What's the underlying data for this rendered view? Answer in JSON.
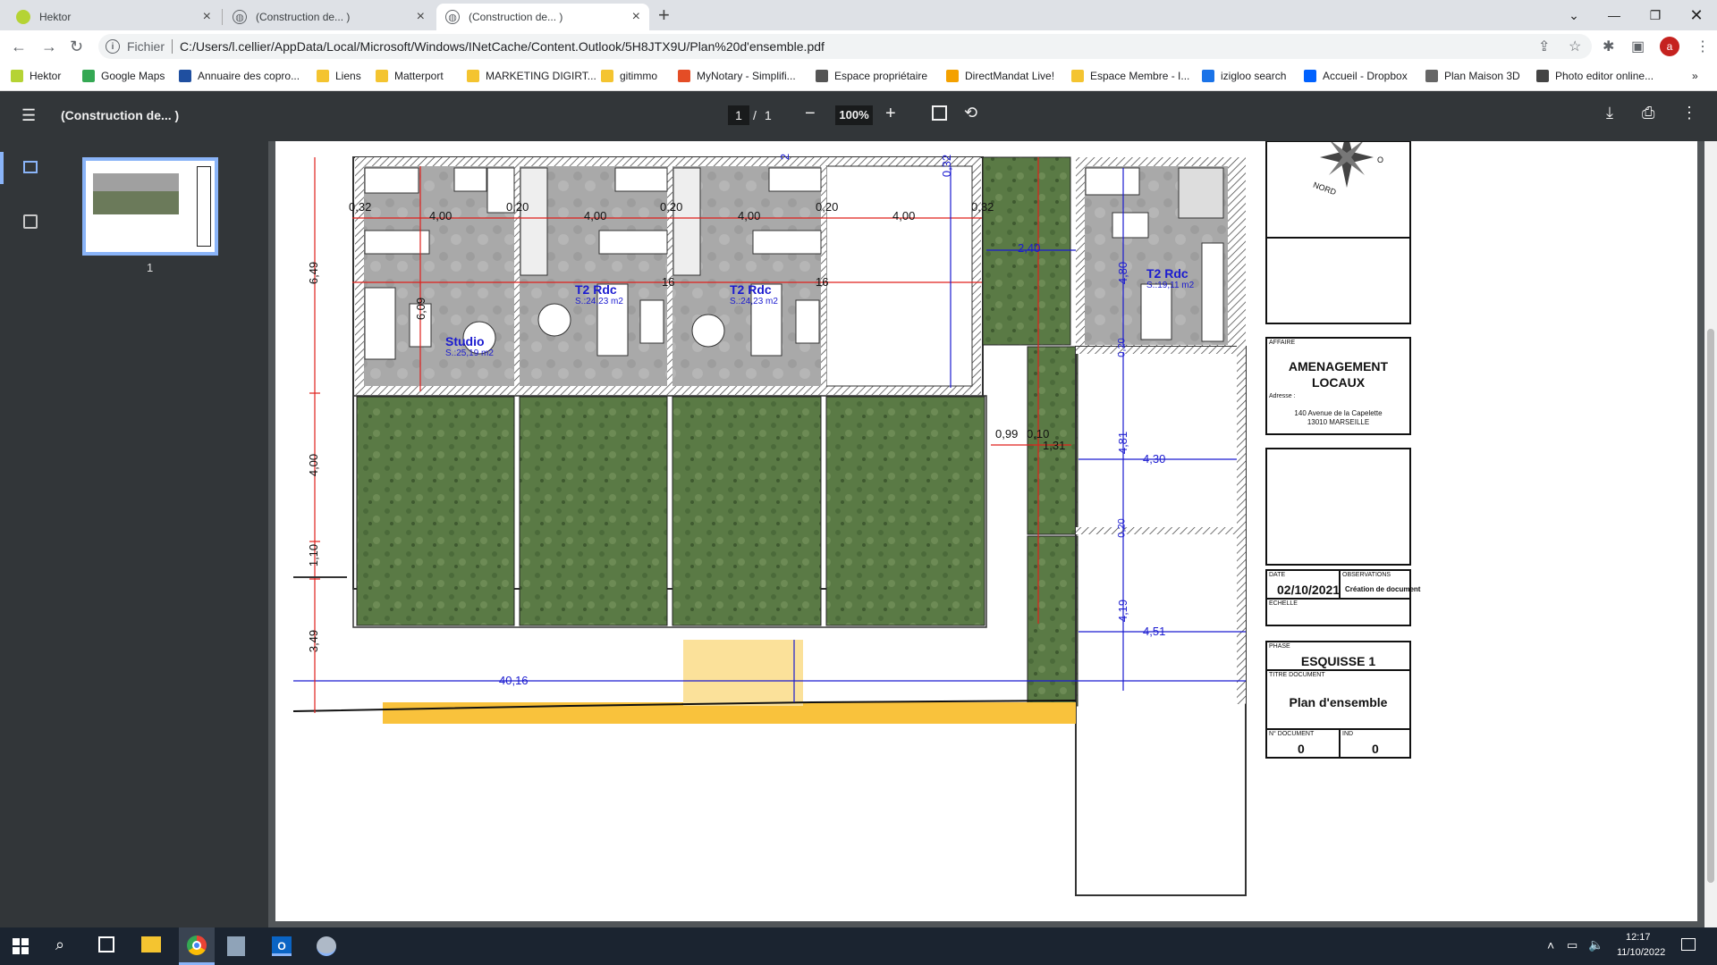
{
  "tabs": [
    {
      "title": "Hektor"
    },
    {
      "title": "(Construction de... )"
    },
    {
      "title": "(Construction de... )"
    }
  ],
  "address": {
    "scheme_label": "Fichier",
    "url": "C:/Users/l.cellier/AppData/Local/Microsoft/Windows/INetCache/Content.Outlook/5H8JTX9U/Plan%20d'ensemble.pdf"
  },
  "profile_initial": "a",
  "bookmarks": [
    {
      "label": "Hektor",
      "color": "#b5d334"
    },
    {
      "label": "Google Maps",
      "color": "#34a853"
    },
    {
      "label": "Annuaire des copro...",
      "color": "#1f4fa0"
    },
    {
      "label": "Liens",
      "color": "#f4c430"
    },
    {
      "label": "Matterport",
      "color": "#f4c430"
    },
    {
      "label": "MARKETING DIGIRT...",
      "color": "#f4c430"
    },
    {
      "label": "gitimmo",
      "color": "#f4c430"
    },
    {
      "label": "MyNotary - Simplifi...",
      "color": "#e44d26"
    },
    {
      "label": "Espace propriétaire",
      "color": "#555555"
    },
    {
      "label": "DirectMandat Live!",
      "color": "#f4a100"
    },
    {
      "label": "Espace Membre - I...",
      "color": "#f4c430"
    },
    {
      "label": "izigloo search",
      "color": "#1a73e8"
    },
    {
      "label": "Accueil - Dropbox",
      "color": "#0061fe"
    },
    {
      "label": "Plan Maison 3D",
      "color": "#666666"
    },
    {
      "label": "Photo editor online...",
      "color": "#444444"
    }
  ],
  "pdf": {
    "title": "(Construction de... )",
    "page_current": "1",
    "page_sep": "/",
    "page_total": "1",
    "zoom": "100%",
    "thumb_label": "1"
  },
  "plan": {
    "dims_top": [
      "0,32",
      "4,00",
      "0,20",
      "4,00",
      "0,20",
      "4,00",
      "0,20",
      "4,00",
      "0,32"
    ],
    "dim_240": "2,40",
    "dim_480": "4,80",
    "dim_609": "6,09",
    "dim_16a": "16",
    "dim_16b": "16",
    "dim_032v": "0,32",
    "dim_2": "2",
    "left_dims": [
      "6,49",
      "4,00",
      "1,10",
      "3,49"
    ],
    "dim_099": "0,99",
    "dim_010": "0,10",
    "dim_131": "1,31",
    "dim_481": "4,81",
    "dim_430": "4,30",
    "dim_020a": "0,20",
    "dim_020b": "0,20",
    "dim_419": "4,19",
    "dim_451": "4,51",
    "dim_4016": "40,16",
    "rooms": [
      {
        "name": "Studio",
        "area": "S.:25,19 m2"
      },
      {
        "name": "T2 Rdc",
        "area": "S.:24,23 m2"
      },
      {
        "name": "T2 Rdc",
        "area": "S.:24,23 m2"
      },
      {
        "name": "T2 Rdc",
        "area": "S.:19,11 m2"
      }
    ],
    "compass": "NORD",
    "compass_o": "O"
  },
  "cartouche": {
    "affaire_label": "AFFAIRE",
    "affaire_line1": "AMENAGEMENT",
    "affaire_line2": "LOCAUX",
    "adresse_label": "Adresse :",
    "adresse_line1": "140 Avenue de la Capelette",
    "adresse_line2": "13010 MARSEILLE",
    "date_label": "DATE",
    "date_value": "02/10/2021",
    "obs_label": "OBSERVATIONS",
    "obs_value": "Création de document",
    "echelle_label": "ECHELLE",
    "phase_label": "PHASE",
    "phase_value": "ESQUISSE 1",
    "titre_label": "TITRE DOCUMENT",
    "titre_value": "Plan d'ensemble",
    "ndoc_label": "N° DOCUMENT",
    "ndoc_value": "0",
    "ind_label": "IND",
    "ind_value": "0"
  },
  "taskbar": {
    "time": "12:17",
    "date": "11/10/2022"
  },
  "colors": {
    "dim_red": "#e0201c",
    "dim_blue": "#1b1bd0",
    "lawn": "#5a7a45",
    "floor": "#a8a8a8",
    "yellow": "#f9c23c"
  }
}
